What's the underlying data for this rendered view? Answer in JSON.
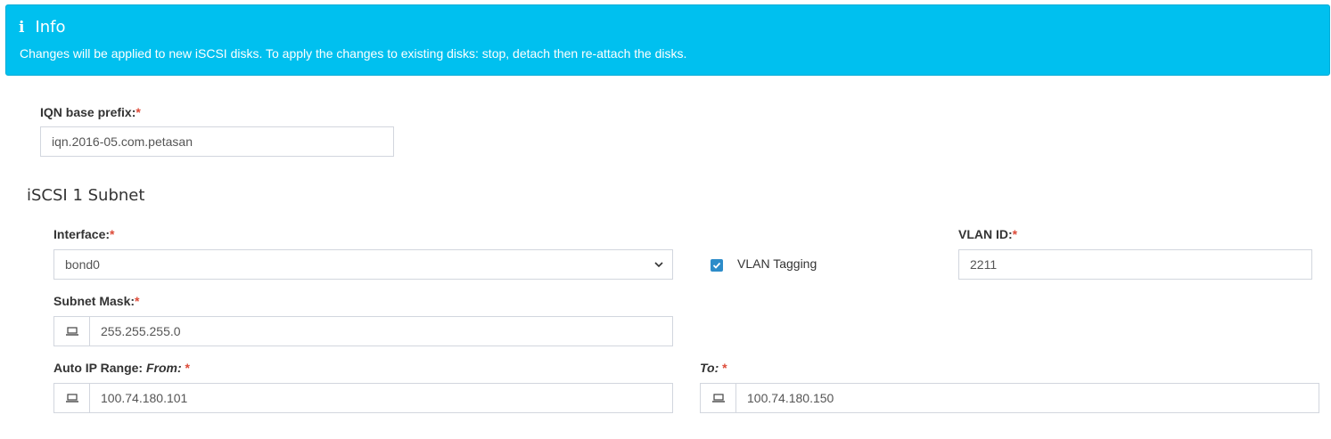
{
  "info": {
    "icon": "info-icon",
    "title": "Info",
    "message": "Changes will be applied to new iSCSI disks. To apply the changes to existing disks: stop, detach then re-attach the disks."
  },
  "iqn": {
    "label": "IQN base prefix:",
    "required": "*",
    "value": "iqn.2016-05.com.petasan"
  },
  "subnet_section": {
    "title": "iSCSI 1 Subnet",
    "interface": {
      "label": "Interface:",
      "required": "*",
      "value": "bond0"
    },
    "vlan_tagging": {
      "label": "VLAN Tagging",
      "checked": true
    },
    "vlan_id": {
      "label": "VLAN ID:",
      "required": "*",
      "value": "2211"
    },
    "subnet_mask": {
      "label": "Subnet Mask:",
      "required": "*",
      "value": "255.255.255.0",
      "icon": "laptop-icon"
    },
    "ip_range": {
      "label": "Auto IP Range: ",
      "from_label": "From:",
      "from_required": "*",
      "from_value": "100.74.180.101",
      "to_label": "To:",
      "to_required": "*",
      "to_value": "100.74.180.150",
      "icon": "laptop-icon"
    }
  },
  "colors": {
    "info_bg": "#00c0ef",
    "required": "#dd4b39",
    "checkbox": "#2d8cc9"
  }
}
